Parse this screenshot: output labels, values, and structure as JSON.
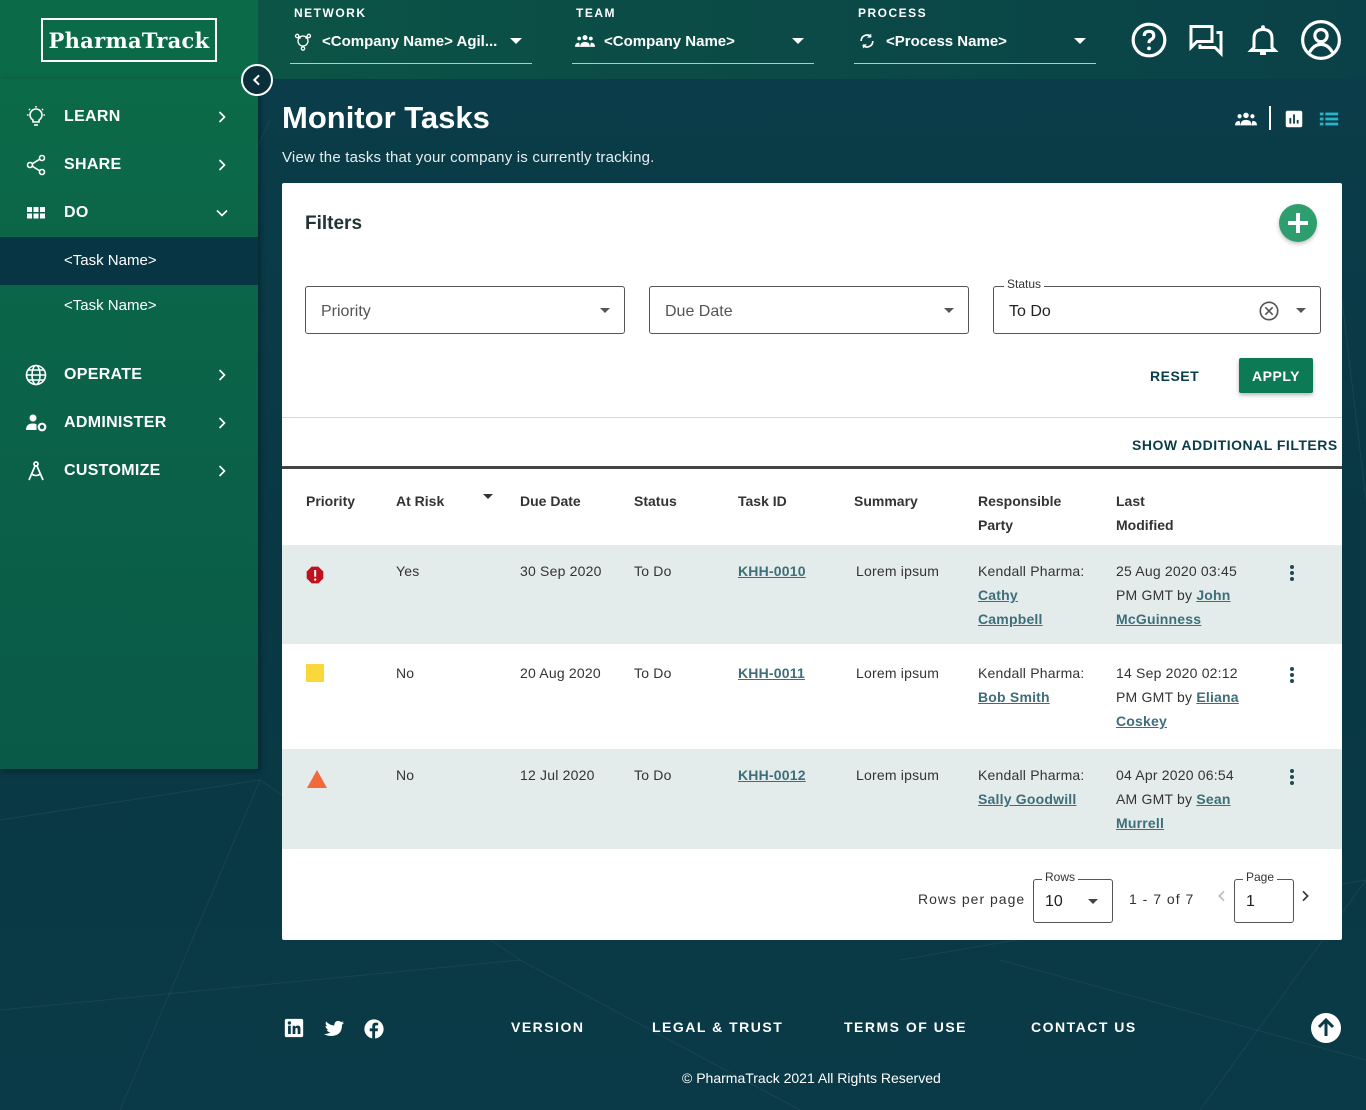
{
  "app": {
    "logo": "PharmaTrack"
  },
  "header": {
    "network": {
      "label": "NETWORK",
      "value": "<Company Name> Agil..."
    },
    "team": {
      "label": "TEAM",
      "value": "<Company Name>"
    },
    "process": {
      "label": "PROCESS",
      "value": "<Process Name>"
    }
  },
  "sidebar": {
    "items": [
      {
        "label": "LEARN",
        "icon": "lightbulb-icon"
      },
      {
        "label": "SHARE",
        "icon": "share-icon"
      },
      {
        "label": "DO",
        "icon": "grid-icon"
      },
      {
        "label": "OPERATE",
        "icon": "globe-icon"
      },
      {
        "label": "ADMINISTER",
        "icon": "user-gear-icon"
      },
      {
        "label": "CUSTOMIZE",
        "icon": "compass-icon"
      }
    ],
    "sub_items": [
      {
        "label": "<Task Name>",
        "active": true
      },
      {
        "label": "<Task Name>",
        "active": false
      }
    ]
  },
  "page": {
    "title": "Monitor Tasks",
    "subtitle": "View the tasks that your company is currently tracking."
  },
  "filters": {
    "title": "Filters",
    "priority_placeholder": "Priority",
    "due_date_placeholder": "Due Date",
    "status_label": "Status",
    "status_value": "To Do",
    "reset_label": "RESET",
    "apply_label": "APPLY",
    "additional_label": "SHOW ADDITIONAL FILTERS"
  },
  "table": {
    "columns": {
      "priority": "Priority",
      "at_risk": "At Risk",
      "due_date": "Due Date",
      "status": "Status",
      "task_id": "Task ID",
      "summary": "Summary",
      "responsible_1": "Responsible",
      "responsible_2": "Party",
      "modified_1": "Last",
      "modified_2": "Modified"
    },
    "rows": [
      {
        "priority_icon": "alert-octagon-icon",
        "priority_color": "#c0121e",
        "at_risk": "Yes",
        "due_date": "30 Sep 2020",
        "status": "To Do",
        "task_id": "KHH-0010",
        "summary": "Lorem ipsum",
        "company": "Kendall Pharma:",
        "person_1": "Cathy",
        "person_2": "Campbell",
        "mod_1": "25 Aug 2020 03:45",
        "mod_2_prefix": "PM GMT by",
        "mod_2_name": "John",
        "mod_3": "McGuinness"
      },
      {
        "priority_icon": "square-icon",
        "priority_color": "#fad73a",
        "at_risk": "No",
        "due_date": "20 Aug 2020",
        "status": "To Do",
        "task_id": "KHH-0011",
        "summary": "Lorem ipsum",
        "company": "Kendall Pharma:",
        "person_1": "Bob Smith",
        "person_2": "",
        "mod_1": "14 Sep 2020 02:12",
        "mod_2_prefix": "PM GMT by",
        "mod_2_name": "Eliana",
        "mod_3": "Coskey"
      },
      {
        "priority_icon": "triangle-icon",
        "priority_color": "#f2693a",
        "at_risk": "No",
        "due_date": "12 Jul 2020",
        "status": "To Do",
        "task_id": "KHH-0012",
        "summary": "Lorem ipsum",
        "company": "Kendall Pharma:",
        "person_1": "Sally Goodwill",
        "person_2": "",
        "mod_1": "04 Apr 2020 06:54",
        "mod_2_prefix": "AM GMT by",
        "mod_2_name": "Sean",
        "mod_3": "Murrell"
      }
    ]
  },
  "pagination": {
    "rows_per_page_label": "Rows per page",
    "rows_label": "Rows",
    "rows_value": "10",
    "range": "1 - 7 of 7",
    "page_label": "Page",
    "page_value": "1"
  },
  "footer": {
    "links": [
      "VERSION",
      "LEGAL & TRUST",
      "TERMS OF USE",
      "CONTACT US"
    ],
    "copyright": "© PharmaTrack 2021 All Rights Reserved"
  },
  "colors": {
    "accent": "#0b7a55",
    "add_button": "#2e9e6e",
    "row_shade": "#e3ecea",
    "link": "#3d6e7a"
  }
}
